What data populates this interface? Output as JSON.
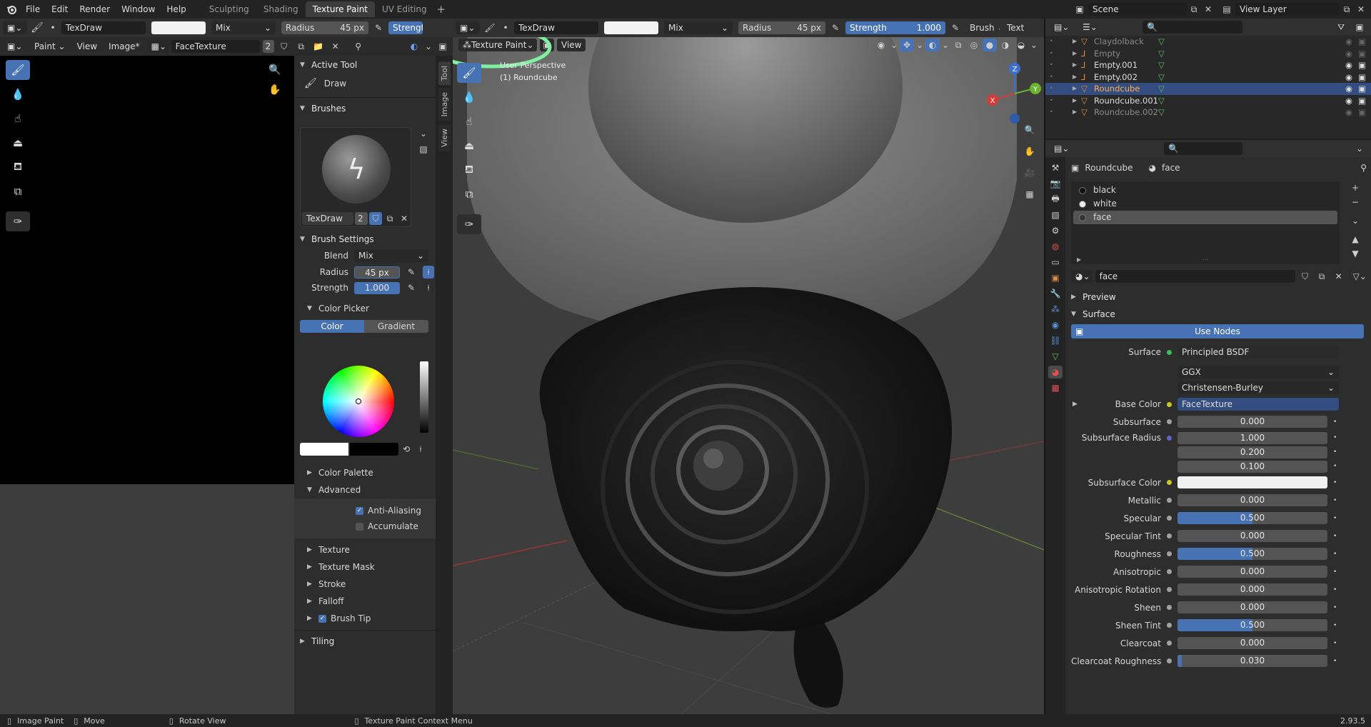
{
  "menubar": {
    "items": [
      "File",
      "Edit",
      "Render",
      "Window",
      "Help"
    ],
    "workspaces": [
      "Sculpting",
      "Shading",
      "Texture Paint",
      "UV Editing"
    ],
    "active_workspace": "Texture Paint",
    "scene": "Scene",
    "view_layer": "View Layer"
  },
  "tool_header_left": {
    "brush_name": "TexDraw",
    "blend": "Mix",
    "radius_label": "Radius",
    "radius_value": "45 px",
    "strength_label": "Strength"
  },
  "tool_header_right": {
    "brush_name": "TexDraw",
    "blend": "Mix",
    "radius_label": "Radius",
    "radius_value": "45 px",
    "strength_label": "Strength",
    "strength_value": "1.000",
    "brush_menu": "Brush",
    "texture_menu": "Text"
  },
  "image_editor_header": {
    "mode": "Paint",
    "view": "View",
    "image_menu": "Image*",
    "image_name": "FaceTexture",
    "users": "2"
  },
  "viewport_header": {
    "mode": "Texture Paint",
    "view": "View"
  },
  "viewport": {
    "perspective_label": "User Perspective",
    "object_label": "(1) Roundcube",
    "gizmo": {
      "x": "X",
      "y": "Y",
      "z": "Z"
    }
  },
  "sidebar": {
    "tabs": [
      "Tool",
      "Image",
      "View"
    ],
    "active_tool_header": "Active Tool",
    "active_tool": "Draw",
    "brushes_header": "Brushes",
    "brush_name": "TexDraw",
    "brush_users": "2",
    "brush_settings_header": "Brush Settings",
    "blend_label": "Blend",
    "blend_value": "Mix",
    "radius_label": "Radius",
    "radius_value": "45 px",
    "strength_label": "Strength",
    "strength_value": "1.000",
    "strength_fraction": 1.0,
    "color_picker_header": "Color Picker",
    "color_tab": "Color",
    "gradient_tab": "Gradient",
    "color_palette": "Color Palette",
    "advanced": "Advanced",
    "anti_aliasing": "Anti-Aliasing",
    "accumulate": "Accumulate",
    "texture": "Texture",
    "texture_mask": "Texture Mask",
    "stroke": "Stroke",
    "falloff": "Falloff",
    "brush_tip": "Brush Tip",
    "tiling": "Tiling"
  },
  "outliner": {
    "items": [
      {
        "name": "Claydolback",
        "dim": true
      },
      {
        "name": "Empty",
        "dim": true
      },
      {
        "name": "Empty.001",
        "dim": false
      },
      {
        "name": "Empty.002",
        "dim": false
      },
      {
        "name": "Roundcube",
        "dim": false,
        "selected": true
      },
      {
        "name": "Roundcube.001",
        "dim": false
      },
      {
        "name": "Roundcube.002",
        "dim": true
      }
    ]
  },
  "properties": {
    "breadcrumb_object": "Roundcube",
    "breadcrumb_material": "face",
    "material_slots": [
      "black",
      "white",
      "face"
    ],
    "active_slot": "face",
    "material_name": "face",
    "preview": "Preview",
    "surface_header": "Surface",
    "use_nodes": "Use Nodes",
    "surface_label": "Surface",
    "surface_value": "Principled BSDF",
    "distribution": "GGX",
    "subsurface_method": "Christensen-Burley",
    "base_color_label": "Base Color",
    "base_color_value": "FaceTexture",
    "params": [
      {
        "label": "Subsurface",
        "value": "0.000",
        "fill": 0
      },
      {
        "label": "Subsurface Radius",
        "value": "1.000",
        "fill": 0
      },
      {
        "label": "",
        "value": "0.200",
        "fill": 0
      },
      {
        "label": "",
        "value": "0.100",
        "fill": 0
      },
      {
        "label": "Subsurface Color",
        "value": "",
        "fill": 0,
        "color": true
      },
      {
        "label": "Metallic",
        "value": "0.000",
        "fill": 0
      },
      {
        "label": "Specular",
        "value": "0.500",
        "fill": 0.5
      },
      {
        "label": "Specular Tint",
        "value": "0.000",
        "fill": 0
      },
      {
        "label": "Roughness",
        "value": "0.500",
        "fill": 0.5
      },
      {
        "label": "Anisotropic",
        "value": "0.000",
        "fill": 0
      },
      {
        "label": "Anisotropic Rotation",
        "value": "0.000",
        "fill": 0
      },
      {
        "label": "Sheen",
        "value": "0.000",
        "fill": 0
      },
      {
        "label": "Sheen Tint",
        "value": "0.500",
        "fill": 0.5
      },
      {
        "label": "Clearcoat",
        "value": "0.000",
        "fill": 0
      },
      {
        "label": "Clearcoat Roughness",
        "value": "0.030",
        "fill": 0.03
      }
    ]
  },
  "statusbar": {
    "image_paint": "Image Paint",
    "move": "Move",
    "rotate_view": "Rotate View",
    "context_menu": "Texture Paint Context Menu",
    "version": "2.93.5"
  },
  "colors": {
    "accent": "#4772b3",
    "selection": "#334d80",
    "annotation": "#7ef0a0"
  }
}
